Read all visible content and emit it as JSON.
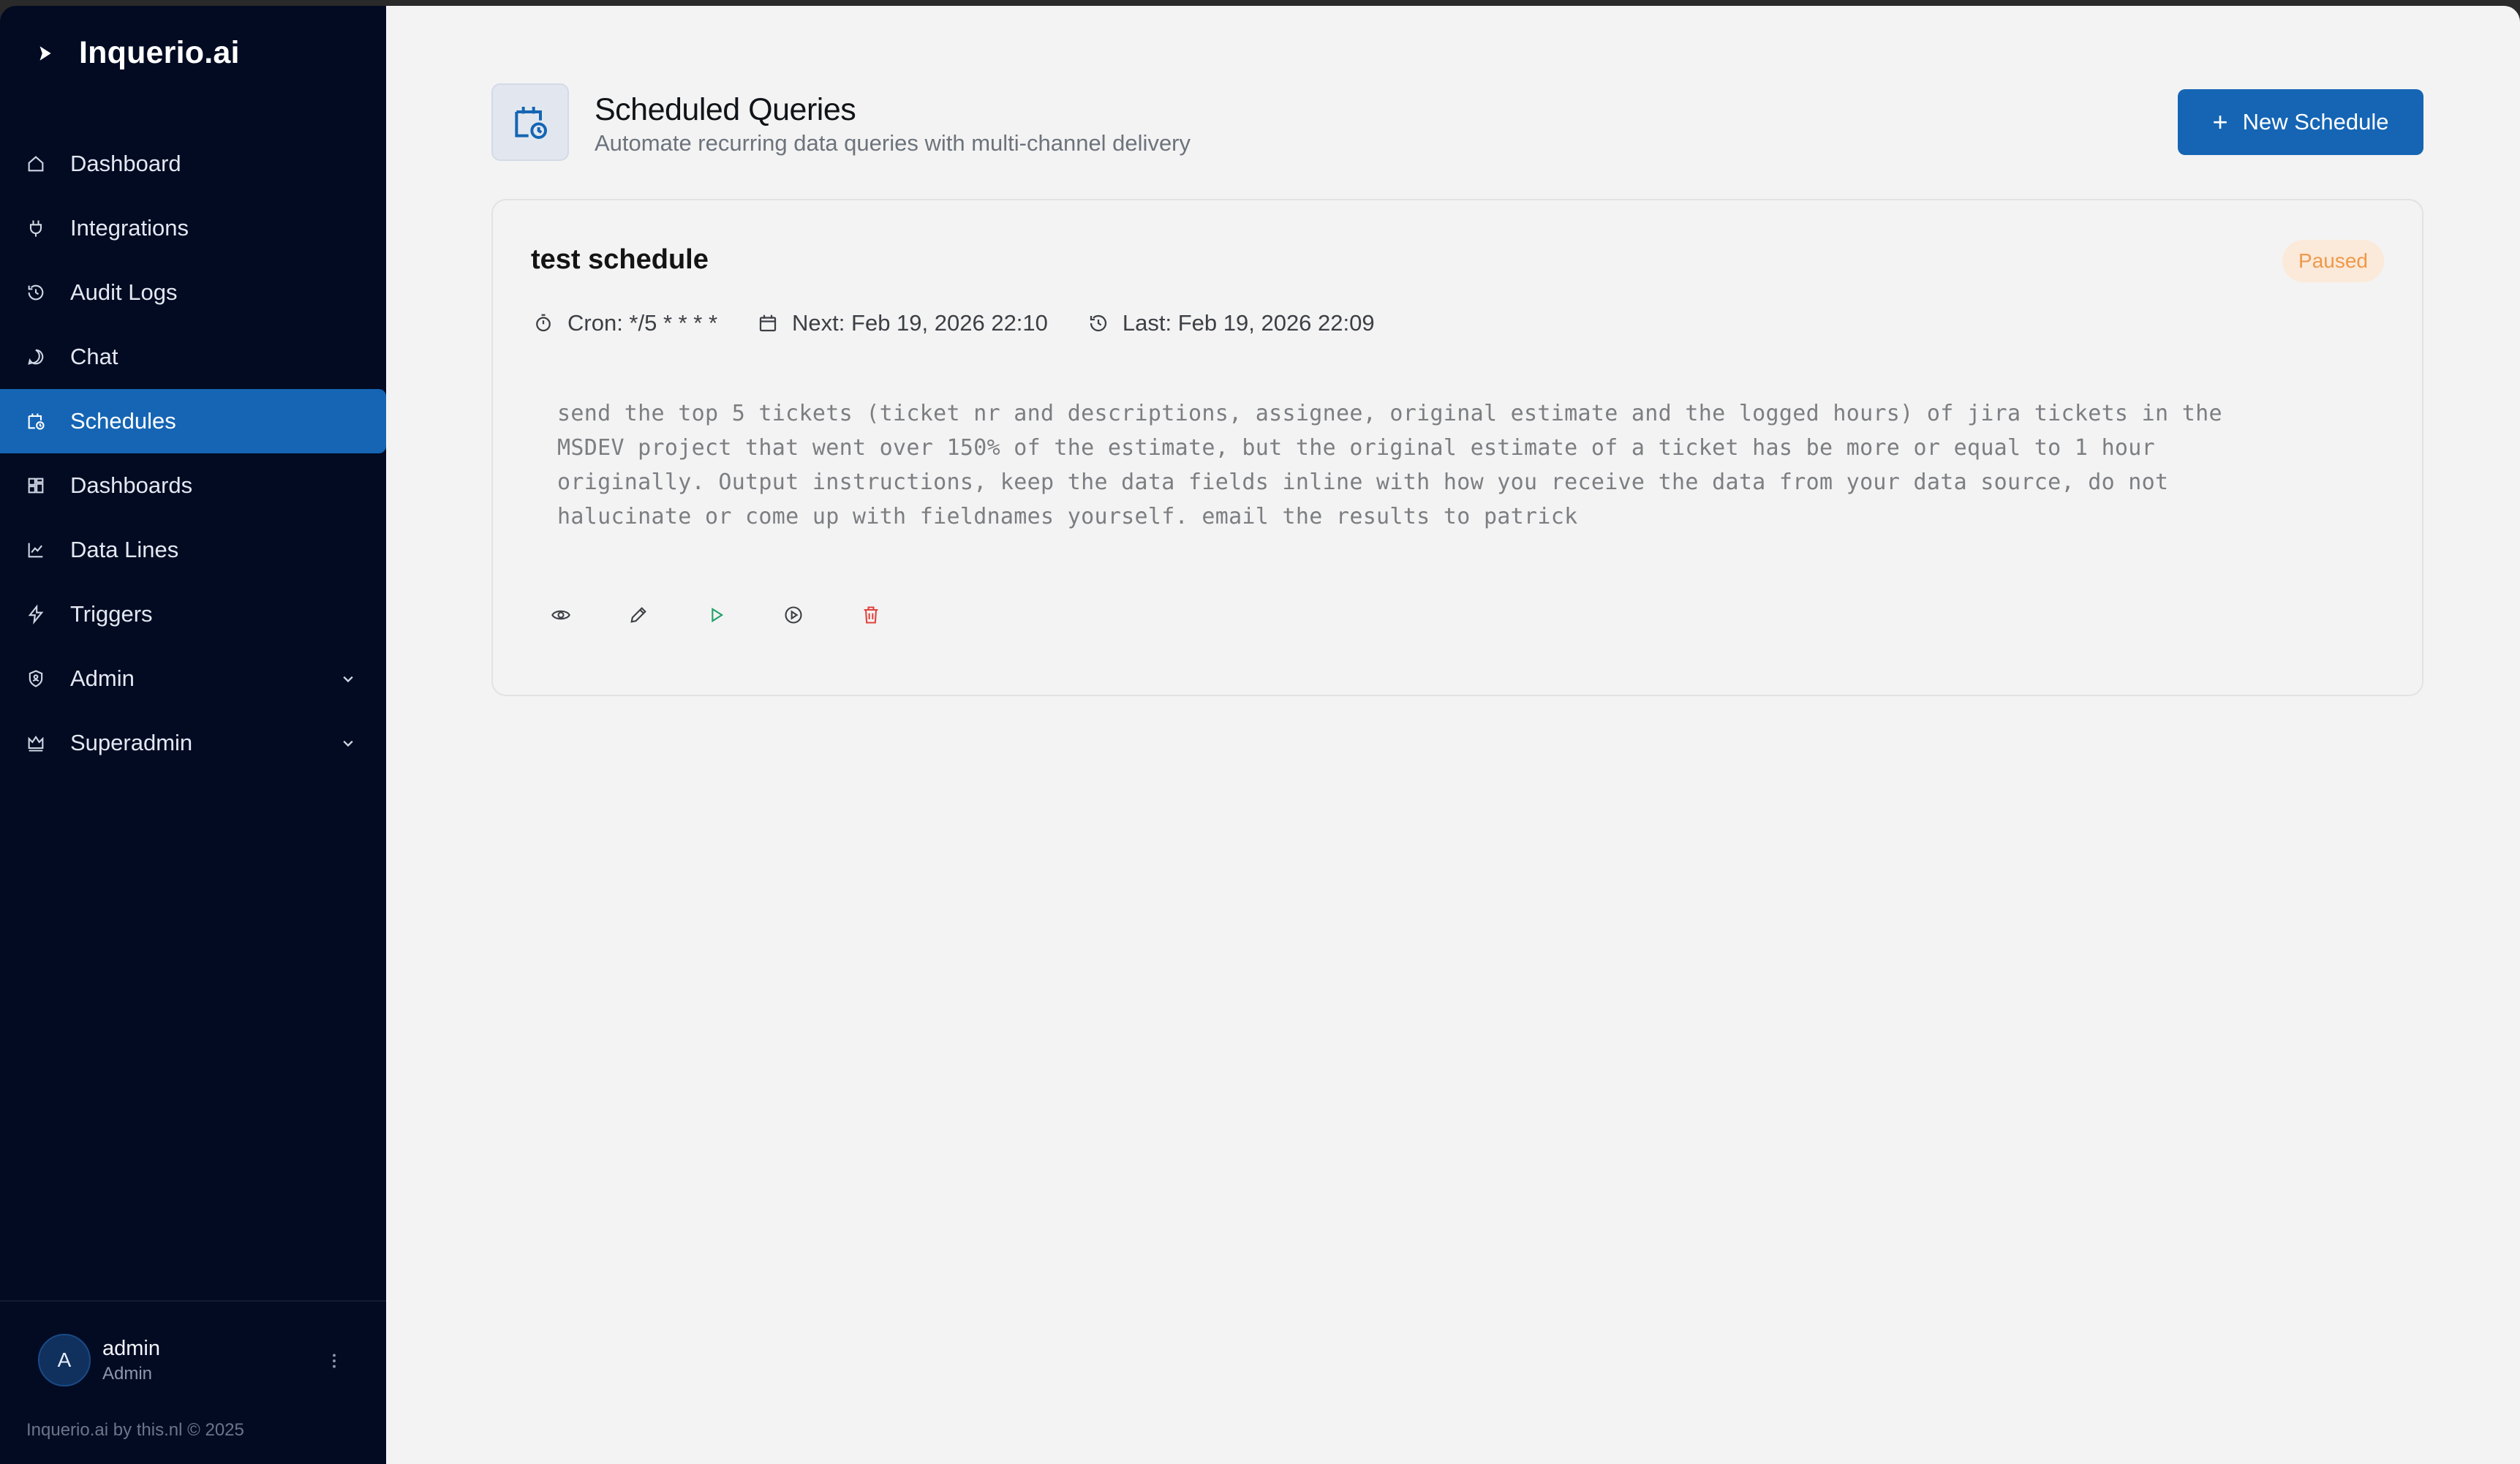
{
  "app": {
    "brand": "Inquerio.ai"
  },
  "sidebar": {
    "items": [
      {
        "label": "Dashboard",
        "icon": "home-icon",
        "active": false
      },
      {
        "label": "Integrations",
        "icon": "plug-icon",
        "active": false
      },
      {
        "label": "Audit Logs",
        "icon": "history-icon",
        "active": false
      },
      {
        "label": "Chat",
        "icon": "chat-icon",
        "active": false
      },
      {
        "label": "Schedules",
        "icon": "calendar-clock-icon",
        "active": true
      },
      {
        "label": "Dashboards",
        "icon": "grid-icon",
        "active": false
      },
      {
        "label": "Data Lines",
        "icon": "line-chart-icon",
        "active": false
      },
      {
        "label": "Triggers",
        "icon": "lightning-icon",
        "active": false
      },
      {
        "label": "Admin",
        "icon": "shield-icon",
        "active": false,
        "expandable": true
      },
      {
        "label": "Superadmin",
        "icon": "crown-icon",
        "active": false,
        "expandable": true
      }
    ],
    "user": {
      "initial": "A",
      "name": "admin",
      "role": "Admin"
    },
    "footer": "Inquerio.ai by this.nl © 2025"
  },
  "header": {
    "title": "Scheduled Queries",
    "subtitle": "Automate recurring data queries with multi-channel delivery",
    "new_button": "New Schedule"
  },
  "schedule": {
    "title": "test schedule",
    "status": "Paused",
    "cron": "Cron: */5 * * * *",
    "next": "Next: Feb 19, 2026 22:10",
    "last": "Last: Feb 19, 2026 22:09",
    "query_lines": [
      "send the top 5 tickets (ticket nr and descriptions, assignee, original estimate and the logged hours) of jira tickets in the",
      "MSDEV project that went over 150% of the estimate, but the original estimate of a ticket has be more or equal to 1 hour",
      "originally. Output instructions, keep the data fields inline with how you receive the data from your data source, do not",
      "halucinate or come up with fieldnames yourself. email the results to patrick"
    ]
  },
  "colors": {
    "sidebar_bg": "#020b22",
    "accent": "#1565b4",
    "paused_text": "#ef9949",
    "paused_bg": "#fbe9da",
    "run_icon": "#22a06b",
    "delete_icon": "#e0433d"
  }
}
